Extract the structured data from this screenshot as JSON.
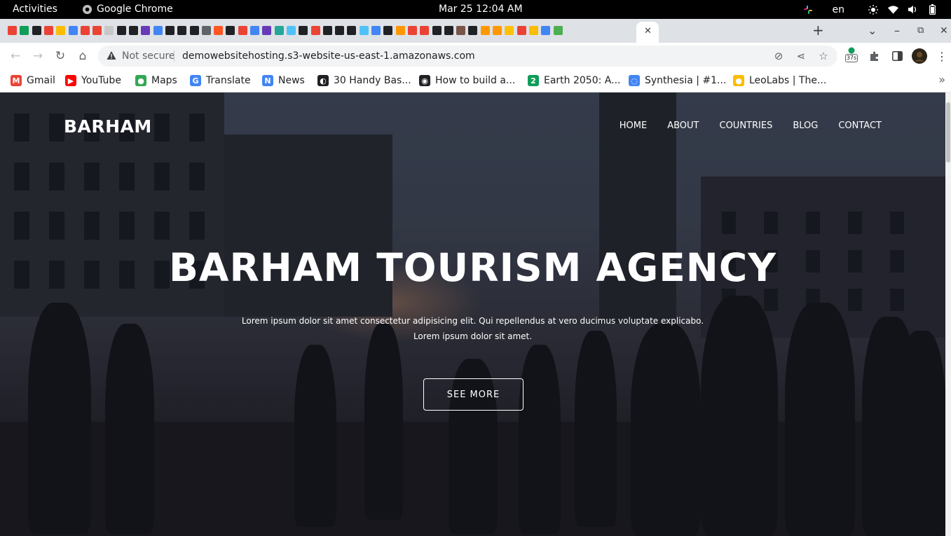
{
  "system": {
    "activities": "Activities",
    "app_name": "Google Chrome",
    "clock": "Mar 25  12:04 AM",
    "lang": "en",
    "icons": [
      "chrome-icon",
      "slack-icon",
      "brightness-icon",
      "wifi-icon",
      "volume-icon",
      "battery-icon"
    ]
  },
  "tabs": {
    "active_close": "✕",
    "new_tab": "+",
    "colors": [
      "#ea4335",
      "#0f9d58",
      "#202124",
      "#ea4335",
      "#fbbc05",
      "#4285f4",
      "#ea4335",
      "#ea4335",
      "#c7c7c7",
      "#202124",
      "#202124",
      "#673ab7",
      "#4285f4",
      "#202124",
      "#202124",
      "#202124",
      "#5f6368",
      "#ff5722",
      "#202124",
      "#ea4335",
      "#4285f4",
      "#673ab7",
      "#26a69a",
      "#4fc3f7",
      "#202124",
      "#ea4335",
      "#202124",
      "#202124",
      "#202124",
      "#4fc3f7",
      "#4285f4",
      "#202124",
      "#ff9800",
      "#ea4335",
      "#ea4335",
      "#202124",
      "#202124",
      "#795548",
      "#202124",
      "#ff9800",
      "#ff9800",
      "#ffc107",
      "#ea4335",
      "#fbbc05",
      "#4285f4",
      "#4caf50"
    ]
  },
  "toolbar": {
    "security": "Not secure",
    "url": "demowebsitehosting.s3-website-us-east-1.amazonaws.com",
    "extension_badge": "37s"
  },
  "bookmarks": [
    {
      "label": "Gmail",
      "icon": "gmail-icon",
      "color": "#ea4335",
      "glyph": "M"
    },
    {
      "label": "YouTube",
      "icon": "youtube-icon",
      "color": "#ff0000",
      "glyph": "▶"
    },
    {
      "label": "Maps",
      "icon": "maps-icon",
      "color": "#34a853",
      "glyph": "●"
    },
    {
      "label": "Translate",
      "icon": "translate-icon",
      "color": "#4285f4",
      "glyph": "G"
    },
    {
      "label": "News",
      "icon": "news-icon",
      "color": "#4285f4",
      "glyph": "N"
    },
    {
      "label": "30 Handy Bas...",
      "icon": "bookmark-site-icon",
      "color": "#202124",
      "glyph": "◐"
    },
    {
      "label": "How to build a...",
      "icon": "github-icon",
      "color": "#202124",
      "glyph": "◉"
    },
    {
      "label": "Earth 2050: A...",
      "icon": "earth2050-icon",
      "color": "#0f9d58",
      "glyph": "2"
    },
    {
      "label": "Synthesia | #1...",
      "icon": "synthesia-icon",
      "color": "#4285f4",
      "glyph": "◌"
    },
    {
      "label": "LeoLabs | The...",
      "icon": "leolabs-icon",
      "color": "#fbbc05",
      "glyph": "●"
    }
  ],
  "site": {
    "brand": "BARHAM",
    "nav": [
      "HOME",
      "ABOUT",
      "COUNTRIES",
      "BLOG",
      "CONTACT"
    ],
    "hero_title": "BARHAM TOURISM AGENCY",
    "hero_sub_1": "Lorem ipsum dolor sit amet consectetur adipisicing elit. Qui repellendus at vero ducimus voluptate explicabo.",
    "hero_sub_2": "Lorem ipsum dolor sit amet.",
    "cta": "SEE MORE"
  }
}
